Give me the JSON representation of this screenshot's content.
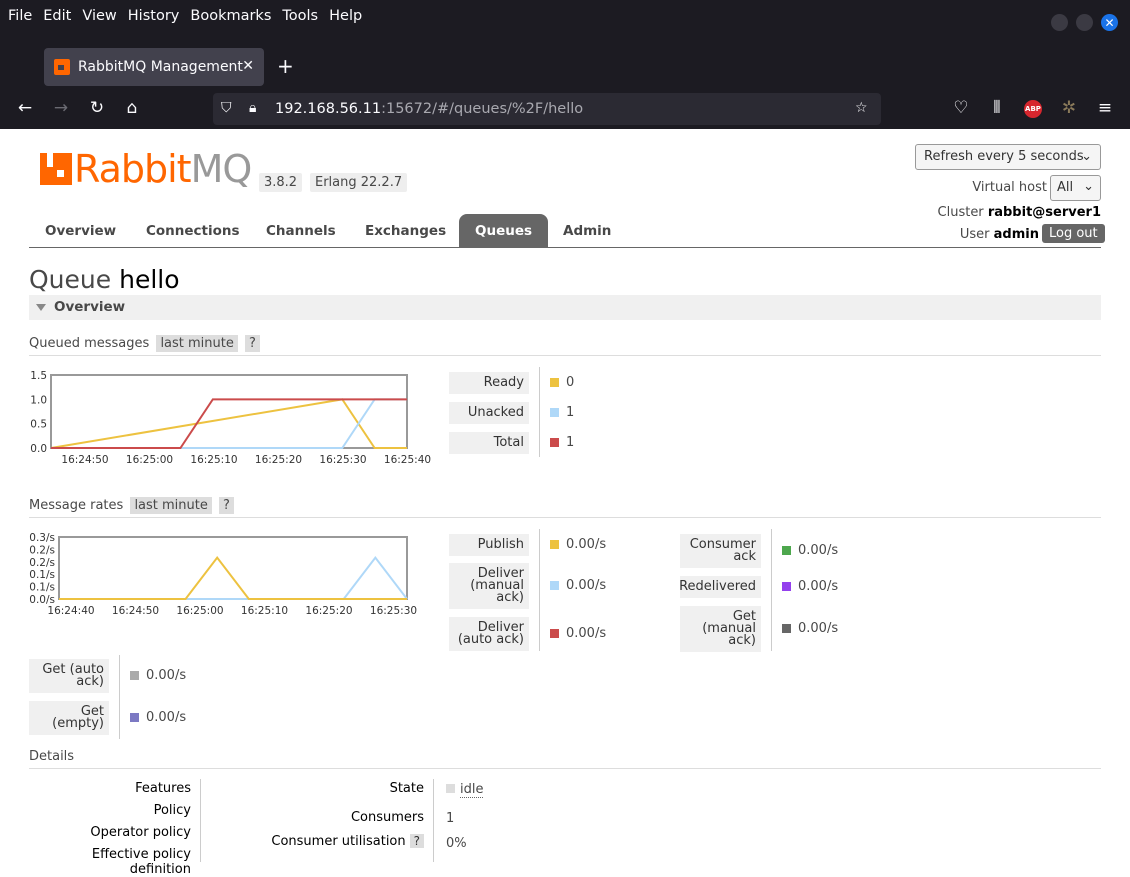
{
  "browser": {
    "menu": [
      "File",
      "Edit",
      "View",
      "History",
      "Bookmarks",
      "Tools",
      "Help"
    ],
    "tab_title": "RabbitMQ Management",
    "url_host": "192.168.56.11",
    "url_rest": ":15672/#/queues/%2F/hello",
    "abp_label": "ABP"
  },
  "header": {
    "logo_rabbit": "Rabbit",
    "logo_mq": "MQ",
    "version": "3.8.2",
    "erlang": "Erlang 22.2.7",
    "refresh": "Refresh every 5 seconds",
    "vhost_label": "Virtual host",
    "vhost_value": "All",
    "cluster_label": "Cluster",
    "cluster_value": "rabbit@server1",
    "user_label": "User",
    "user_value": "admin",
    "logout": "Log out"
  },
  "nav": [
    "Overview",
    "Connections",
    "Channels",
    "Exchanges",
    "Queues",
    "Admin"
  ],
  "title_prefix": "Queue",
  "title_name": "hello",
  "overview_label": "Overview",
  "queued": {
    "label": "Queued messages",
    "range": "last minute",
    "help": "?",
    "legend": [
      {
        "label": "Ready",
        "value": "0",
        "color": "#edc240"
      },
      {
        "label": "Unacked",
        "value": "1",
        "color": "#afd8f8"
      },
      {
        "label": "Total",
        "value": "1",
        "color": "#cb4b4b"
      }
    ]
  },
  "rates": {
    "label": "Message rates",
    "range": "last minute",
    "help": "?",
    "legend_left": [
      {
        "label": "Publish",
        "value": "0.00/s",
        "color": "#edc240"
      },
      {
        "label": "Deliver (manual ack)",
        "value": "0.00/s",
        "color": "#afd8f8"
      },
      {
        "label": "Deliver (auto ack)",
        "value": "0.00/s",
        "color": "#cb4b4b"
      }
    ],
    "legend_right": [
      {
        "label": "Consumer ack",
        "value": "0.00/s",
        "color": "#4da74d"
      },
      {
        "label": "Redelivered",
        "value": "0.00/s",
        "color": "#9440ed"
      },
      {
        "label": "Get (manual ack)",
        "value": "0.00/s",
        "color": "#666666"
      }
    ],
    "legend_bottom": [
      {
        "label": "Get (auto ack)",
        "value": "0.00/s",
        "color": "#aaaaaa"
      },
      {
        "label": "Get (empty)",
        "value": "0.00/s",
        "color": "#7c79c3"
      }
    ]
  },
  "details": {
    "label": "Details",
    "left_labels": [
      "Features",
      "Policy",
      "Operator policy",
      "Effective policy definition"
    ],
    "state_label": "State",
    "state_value": "idle",
    "consumers_label": "Consumers",
    "consumers_value": "1",
    "util_label": "Consumer utilisation",
    "util_help": "?",
    "util_value": "0%"
  },
  "chart_data": [
    {
      "type": "line",
      "x": [
        "16:24:50",
        "16:25:00",
        "16:25:10",
        "16:25:20",
        "16:25:30",
        "16:25:40"
      ],
      "ylim": [
        0,
        1.5
      ],
      "yticks": [
        "1.5",
        "1.0",
        "0.5",
        "0.0"
      ],
      "series": [
        {
          "name": "Total",
          "color": "#cb4b4b",
          "points": [
            [
              0,
              0
            ],
            [
              20,
              0
            ],
            [
              25,
              1
            ],
            [
              55,
              1
            ]
          ]
        },
        {
          "name": "Unacked",
          "color": "#afd8f8",
          "points": [
            [
              0,
              0
            ],
            [
              45,
              0
            ],
            [
              50,
              1
            ],
            [
              55,
              1
            ]
          ]
        },
        {
          "name": "Ready",
          "color": "#edc240",
          "points": [
            [
              0,
              0
            ],
            [
              45,
              1
            ],
            [
              50,
              0
            ],
            [
              55,
              0
            ]
          ]
        }
      ]
    },
    {
      "type": "line",
      "x": [
        "16:24:40",
        "16:24:50",
        "16:25:00",
        "16:25:10",
        "16:25:20",
        "16:25:30"
      ],
      "ylim": [
        0,
        0.3
      ],
      "yticks": [
        "0.3/s",
        "0.2/s",
        "0.2/s",
        "0.1/s",
        "0.1/s",
        "0.0/s"
      ],
      "series": [
        {
          "name": "Publish",
          "color": "#edc240",
          "points": [
            [
              0,
              0
            ],
            [
              20,
              0
            ],
            [
              25,
              0.2
            ],
            [
              30,
              0
            ],
            [
              55,
              0
            ]
          ]
        },
        {
          "name": "Deliver (manual ack)",
          "color": "#afd8f8",
          "points": [
            [
              0,
              0
            ],
            [
              45,
              0
            ],
            [
              50,
              0.2
            ],
            [
              55,
              0
            ]
          ]
        },
        {
          "name": "Deliver (auto ack)",
          "color": "#cb4b4b",
          "points": [
            [
              0,
              0
            ],
            [
              55,
              0
            ]
          ]
        }
      ]
    }
  ]
}
